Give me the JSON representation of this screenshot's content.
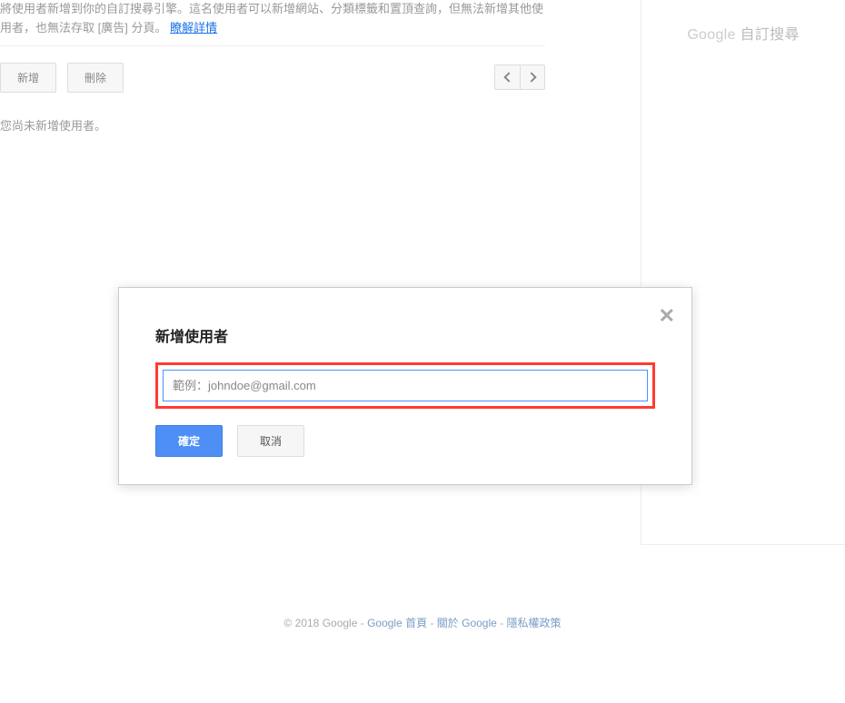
{
  "description": {
    "text": "將使用者新增到你的自訂搜尋引擎。這名使用者可以新增網站、分類標籤和置頂查詢，但無法新增其他使用者，也無法存取 [廣告] 分頁。",
    "link": "瞭解詳情"
  },
  "toolbar": {
    "add_label": "新增",
    "delete_label": "刪除"
  },
  "empty_message": "您尚未新增使用者。",
  "sidebar": {
    "logo_brand": "Google",
    "logo_text": "自訂搜尋"
  },
  "dialog": {
    "title": "新增使用者",
    "input_placeholder": "範例：johndoe@gmail.com",
    "confirm_label": "確定",
    "cancel_label": "取消"
  },
  "footer": {
    "copyright": "© 2018 Google  - ",
    "home_link": "Google 首頁",
    "sep1": " - ",
    "about_link": "關於 Google",
    "sep2": " - ",
    "privacy_link": "隱私權政策"
  }
}
